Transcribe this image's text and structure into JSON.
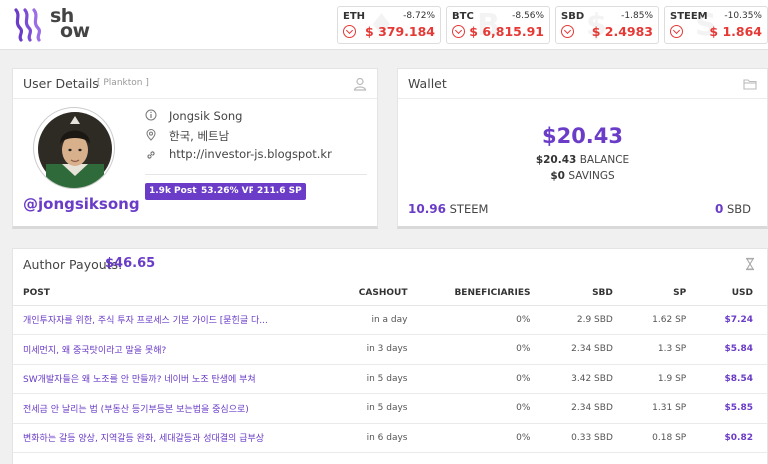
{
  "brand": {
    "line1": "sh",
    "line2": "ow"
  },
  "tickers": [
    {
      "symbol": "ETH",
      "change": "-8.72%",
      "price": "$ 379.184",
      "bg": "♦"
    },
    {
      "symbol": "BTC",
      "change": "-8.56%",
      "price": "$ 6,815.91",
      "bg": "B"
    },
    {
      "symbol": "SBD",
      "change": "-1.85%",
      "price": "$ 2.4983",
      "bg": "$"
    },
    {
      "symbol": "STEEM",
      "change": "-10.35%",
      "price": "$ 1.864",
      "bg": "S"
    }
  ],
  "user": {
    "title": "User Details",
    "rank": "[ Plankton ]",
    "name": "Jongsik Song",
    "location": "한국, 베트남",
    "website": "http://investor-js.blogspot.kr",
    "handle": "@jongsiksong",
    "badges": {
      "posts": "1.9k Posts",
      "vp": "53.26% VP",
      "sp": "211.6 SP"
    }
  },
  "wallet": {
    "title": "Wallet",
    "total": "$20.43",
    "balance_value": "$20.43",
    "balance_label": "BALANCE",
    "savings_value": "$0",
    "savings_label": "SAVINGS",
    "steem_value": "10.96",
    "steem_label": "STEEM",
    "sbd_value": "0",
    "sbd_label": "SBD"
  },
  "payouts": {
    "label": "Author Payouts:",
    "amount": "$46.65",
    "columns": {
      "post": "POST",
      "cashout": "CASHOUT",
      "beneficiaries": "BENEFICIARIES",
      "sbd": "SBD",
      "sp": "SP",
      "usd": "USD"
    },
    "rows": [
      {
        "post": "개인투자자를 위한, 주식 투자 프로세스 기본 가이드 [묻힌글 다...",
        "cashout": "in a day",
        "beneficiaries": "0%",
        "sbd": "2.9 SBD",
        "sp": "1.62 SP",
        "usd": "$7.24"
      },
      {
        "post": "미세먼지, 왜 중국탓이라고 말을 못해?",
        "cashout": "in 3 days",
        "beneficiaries": "0%",
        "sbd": "2.34 SBD",
        "sp": "1.3 SP",
        "usd": "$5.84"
      },
      {
        "post": "SW개발자들은 왜 노조를 안 만들까? 네이버 노조 탄생에 부쳐",
        "cashout": "in 5 days",
        "beneficiaries": "0%",
        "sbd": "3.42 SBD",
        "sp": "1.9 SP",
        "usd": "$8.54"
      },
      {
        "post": "전세금 안 날리는 법 (부동산 등기부등본 보는법을 중심으로)",
        "cashout": "in 5 days",
        "beneficiaries": "0%",
        "sbd": "2.34 SBD",
        "sp": "1.31 SP",
        "usd": "$5.85"
      },
      {
        "post": "변화하는 갈등 양상, 지역갈등 완화, 세대갈등과 성대결의 급부상",
        "cashout": "in 6 days",
        "beneficiaries": "0%",
        "sbd": "0.33 SBD",
        "sp": "0.18 SP",
        "usd": "$0.82"
      }
    ]
  },
  "colors": {
    "accent": "#6a3cc7",
    "negative": "#e53935"
  },
  "icons": [
    "steem-logo-icon",
    "down-arrow-icon",
    "user-icon",
    "info-icon",
    "location-pin-icon",
    "link-icon",
    "folder-icon",
    "hourglass-icon"
  ]
}
